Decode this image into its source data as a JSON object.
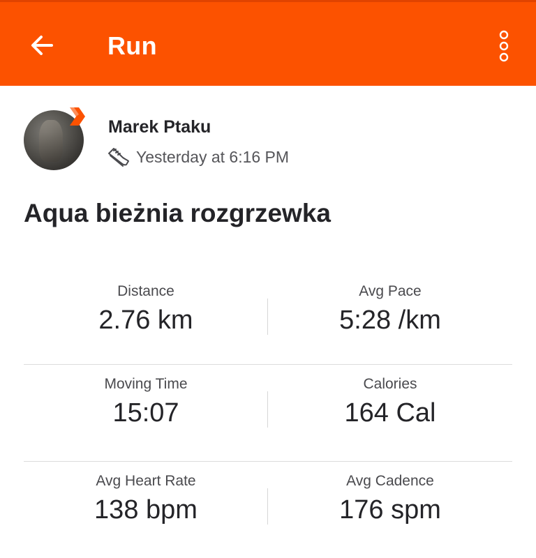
{
  "appbar": {
    "title": "Run",
    "back_icon": "arrow-left-icon",
    "more_icon": "more-vertical-icon",
    "color": "#fc5200"
  },
  "athlete": {
    "name": "Marek Ptaku",
    "activity_icon": "running-shoe-icon",
    "timestamp": "Yesterday at 6:16 PM"
  },
  "activity": {
    "title": "Aqua bieżnia rozgrzewka"
  },
  "stats": [
    [
      {
        "label": "Distance",
        "value": "2.76 km"
      },
      {
        "label": "Avg Pace",
        "value": "5:28 /km"
      }
    ],
    [
      {
        "label": "Moving Time",
        "value": "15:07"
      },
      {
        "label": "Calories",
        "value": "164 Cal"
      }
    ],
    [
      {
        "label": "Avg Heart Rate",
        "value": "138 bpm"
      },
      {
        "label": "Avg Cadence",
        "value": "176 spm"
      }
    ]
  ]
}
